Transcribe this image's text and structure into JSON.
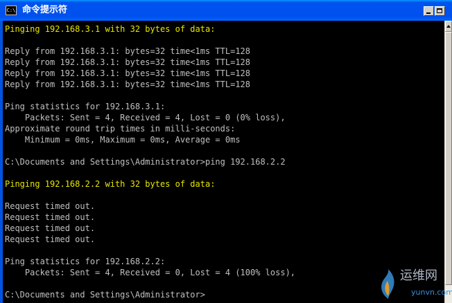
{
  "window": {
    "title": "命令提示符",
    "icon_text": "C:\\",
    "icon": "cmd-icon"
  },
  "console": {
    "text_color": "#c0c0c0",
    "highlight_color": "#e8e800",
    "background": "#000000",
    "lines": [
      {
        "text": "Pinging 192.168.3.1 with 32 bytes of data:",
        "highlight": true
      },
      {
        "text": "",
        "highlight": false
      },
      {
        "text": "Reply from 192.168.3.1: bytes=32 time<1ms TTL=128",
        "highlight": false
      },
      {
        "text": "Reply from 192.168.3.1: bytes=32 time<1ms TTL=128",
        "highlight": false
      },
      {
        "text": "Reply from 192.168.3.1: bytes=32 time<1ms TTL=128",
        "highlight": false
      },
      {
        "text": "Reply from 192.168.3.1: bytes=32 time<1ms TTL=128",
        "highlight": false
      },
      {
        "text": "",
        "highlight": false
      },
      {
        "text": "Ping statistics for 192.168.3.1:",
        "highlight": false
      },
      {
        "text": "    Packets: Sent = 4, Received = 4, Lost = 0 (0% loss),",
        "highlight": false
      },
      {
        "text": "Approximate round trip times in milli-seconds:",
        "highlight": false
      },
      {
        "text": "    Minimum = 0ms, Maximum = 0ms, Average = 0ms",
        "highlight": false
      },
      {
        "text": "",
        "highlight": false
      },
      {
        "text": "C:\\Documents and Settings\\Administrator>ping 192.168.2.2",
        "highlight": false
      },
      {
        "text": "",
        "highlight": false
      },
      {
        "text": "Pinging 192.168.2.2 with 32 bytes of data:",
        "highlight": true
      },
      {
        "text": "",
        "highlight": false
      },
      {
        "text": "Request timed out.",
        "highlight": false
      },
      {
        "text": "Request timed out.",
        "highlight": false
      },
      {
        "text": "Request timed out.",
        "highlight": false
      },
      {
        "text": "Request timed out.",
        "highlight": false
      },
      {
        "text": "",
        "highlight": false
      },
      {
        "text": "Ping statistics for 192.168.2.2:",
        "highlight": false
      },
      {
        "text": "    Packets: Sent = 4, Received = 0, Lost = 4 (100% loss),",
        "highlight": false
      },
      {
        "text": "",
        "highlight": false
      },
      {
        "text": "C:\\Documents and Settings\\Administrator>",
        "highlight": false
      }
    ]
  },
  "watermark": {
    "text": "运维网",
    "subtext": "yunvn.com"
  }
}
